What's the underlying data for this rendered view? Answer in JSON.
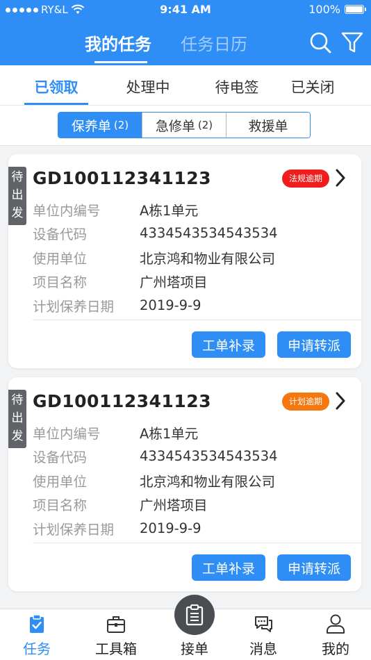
{
  "status_bar": {
    "carrier": "RY&L",
    "time": "9:41 AM",
    "battery": "100%"
  },
  "header": {
    "tabs": [
      "我的任务",
      "任务日历"
    ],
    "active_tab": 0,
    "icons": [
      "search-icon",
      "filter-icon"
    ]
  },
  "status_tabs": [
    "已领取",
    "处理中",
    "待电签",
    "已关闭"
  ],
  "segments": [
    {
      "label": "保养单",
      "count": "(2)"
    },
    {
      "label": "急修单",
      "count": "(2)"
    },
    {
      "label": "救援单",
      "count": ""
    }
  ],
  "cards": [
    {
      "side_tag": [
        "待",
        "出",
        "发"
      ],
      "order_no": "GD100112341123",
      "badge": "法规逾期",
      "badge_color": "#f11d1d",
      "rows": [
        {
          "label": "单位内编号",
          "value": "A栋1单元"
        },
        {
          "label": "设备代码",
          "value": "4334543534543534"
        },
        {
          "label": "使用单位",
          "value": "北京鸿和物业有限公司"
        },
        {
          "label": "项目名称",
          "value": "广州塔项目"
        },
        {
          "label": "计划保养日期",
          "value": "2019-9-9"
        }
      ],
      "buttons": [
        "工单补录",
        "申请转派"
      ]
    },
    {
      "side_tag": [
        "待",
        "出",
        "发"
      ],
      "order_no": "GD100112341123",
      "badge": "计划逾期",
      "badge_color": "#f6770d",
      "rows": [
        {
          "label": "单位内编号",
          "value": "A栋1单元"
        },
        {
          "label": "设备代码",
          "value": "4334543534543534"
        },
        {
          "label": "使用单位",
          "value": "北京鸿和物业有限公司"
        },
        {
          "label": "项目名称",
          "value": "广州塔项目"
        },
        {
          "label": "计划保养日期",
          "value": "2019-9-9"
        }
      ],
      "buttons": [
        "工单补录",
        "申请转派"
      ]
    }
  ],
  "bottom_nav": [
    {
      "label": "任务",
      "icon": "clipboard-check-icon",
      "active": true
    },
    {
      "label": "工具箱",
      "icon": "toolbox-icon",
      "active": false
    },
    {
      "label": "接单",
      "icon": "document-icon",
      "active": false
    },
    {
      "label": "消息",
      "icon": "chat-icon",
      "active": false
    },
    {
      "label": "我的",
      "icon": "user-icon",
      "active": false
    }
  ],
  "colors": {
    "primary": "#2f8ef5",
    "tag_gray": "#606468",
    "label_gray": "#9a9a9a"
  }
}
